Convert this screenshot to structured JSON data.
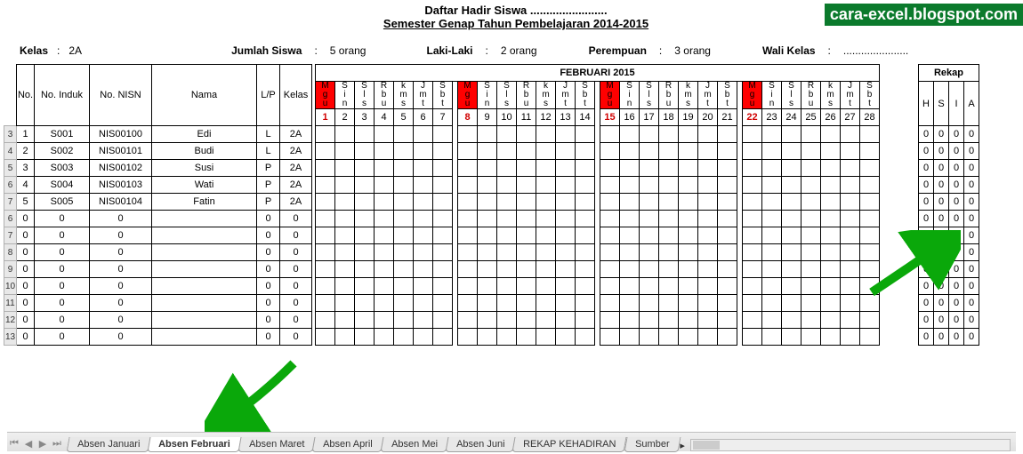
{
  "watermark": "cara-excel.blogspot.com",
  "titles": {
    "line1": "Daftar Hadir Siswa ........................",
    "line2": "Semester Genap Tahun Pembelajaran 2014-2015"
  },
  "meta": {
    "kelas_label": "Kelas",
    "kelas_value": "2A",
    "jumlah_label": "Jumlah Siswa",
    "jumlah_value": "5 orang",
    "laki_label": "Laki-Laki",
    "laki_value": "2 orang",
    "perempuan_label": "Perempuan",
    "perempuan_value": "3 orang",
    "wali_label": "Wali Kelas",
    "wali_value": "......................"
  },
  "month_header": "FEBRUARI 2015",
  "rekap_header": "Rekap",
  "cols": {
    "no": "No.",
    "induk": "No. Induk",
    "nisn": "No. NISN",
    "nama": "Nama",
    "lp": "L/P",
    "kelas": "Kelas",
    "H": "H",
    "S": "S",
    "I": "I",
    "A": "A"
  },
  "days": [
    {
      "n": 1,
      "top": "M g u",
      "sun": true
    },
    {
      "n": 2,
      "top": "S i n"
    },
    {
      "n": 3,
      "top": "S l s"
    },
    {
      "n": 4,
      "top": "R b u"
    },
    {
      "n": 5,
      "top": "k m s"
    },
    {
      "n": 6,
      "top": "J m t"
    },
    {
      "n": 7,
      "top": "S b t"
    },
    {
      "n": 8,
      "top": "M g u",
      "sun": true
    },
    {
      "n": 9,
      "top": "S i n"
    },
    {
      "n": 10,
      "top": "S l s"
    },
    {
      "n": 11,
      "top": "R b u"
    },
    {
      "n": 12,
      "top": "k m s"
    },
    {
      "n": 13,
      "top": "J m t"
    },
    {
      "n": 14,
      "top": "S b t"
    },
    {
      "n": 15,
      "top": "M g u",
      "sun": true
    },
    {
      "n": 16,
      "top": "S i n"
    },
    {
      "n": 17,
      "top": "S l s"
    },
    {
      "n": 18,
      "top": "R b u"
    },
    {
      "n": 19,
      "top": "k m s"
    },
    {
      "n": 20,
      "top": "J m t"
    },
    {
      "n": 21,
      "top": "S b t"
    },
    {
      "n": 22,
      "top": "M g u",
      "sun": true
    },
    {
      "n": 23,
      "top": "S i n"
    },
    {
      "n": 24,
      "top": "S l s"
    },
    {
      "n": 25,
      "top": "R b u"
    },
    {
      "n": 26,
      "top": "k m s"
    },
    {
      "n": 27,
      "top": "J m t"
    },
    {
      "n": 28,
      "top": "S b t"
    }
  ],
  "students": [
    {
      "row": 1,
      "induk": "S001",
      "nisn": "NIS00100",
      "nama": "Edi",
      "lp": "L",
      "kelas": "2A",
      "rekap": [
        0,
        0,
        0,
        0
      ]
    },
    {
      "row": 2,
      "induk": "S002",
      "nisn": "NIS00101",
      "nama": "Budi",
      "lp": "L",
      "kelas": "2A",
      "rekap": [
        0,
        0,
        0,
        0
      ]
    },
    {
      "row": 3,
      "induk": "S003",
      "nisn": "NIS00102",
      "nama": "Susi",
      "lp": "P",
      "kelas": "2A",
      "rekap": [
        0,
        0,
        0,
        0
      ]
    },
    {
      "row": 4,
      "induk": "S004",
      "nisn": "NIS00103",
      "nama": "Wati",
      "lp": "P",
      "kelas": "2A",
      "rekap": [
        0,
        0,
        0,
        0
      ]
    },
    {
      "row": 5,
      "induk": "S005",
      "nisn": "NIS00104",
      "nama": "Fatin",
      "lp": "P",
      "kelas": "2A",
      "rekap": [
        0,
        0,
        0,
        0
      ]
    }
  ],
  "empty_rows": [
    6,
    7,
    8,
    9,
    10,
    11,
    12,
    13
  ],
  "tabs": [
    "Absen Januari",
    "Absen Februari",
    "Absen Maret",
    "Absen April",
    "Absen Mei",
    "Absen Juni",
    "REKAP KEHADIRAN",
    "Sumber"
  ],
  "active_tab": 1
}
